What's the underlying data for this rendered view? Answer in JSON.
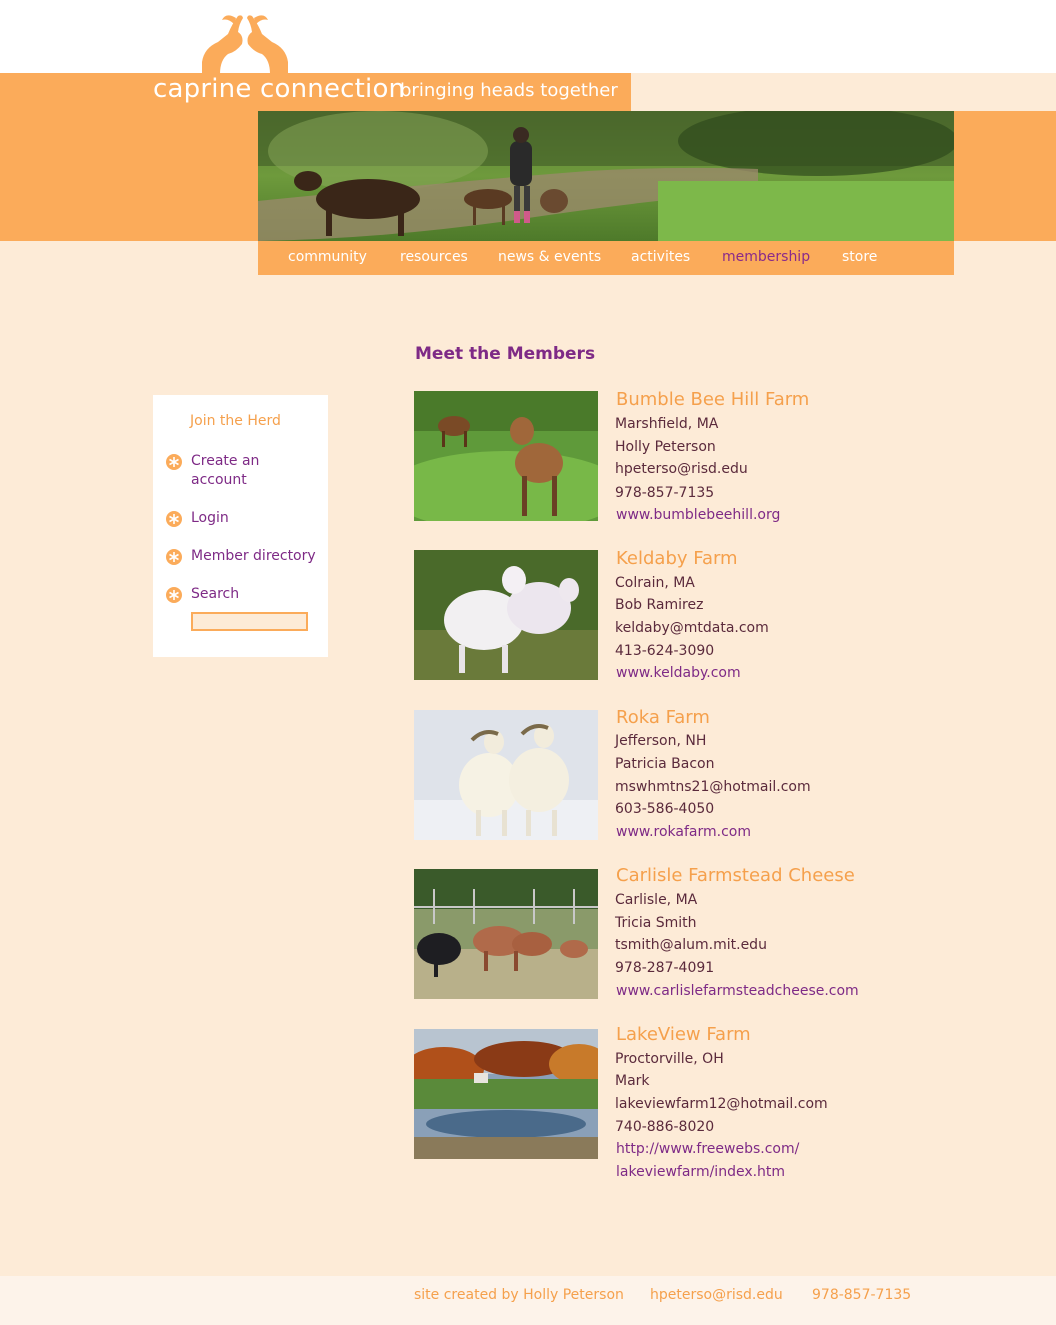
{
  "brand": {
    "name": "caprine connection",
    "tagline": "bringing heads together"
  },
  "colors": {
    "orange": "#fbab5a",
    "purple": "#7e2a86",
    "cream": "#fdebd7"
  },
  "nav": [
    {
      "label": "community"
    },
    {
      "label": "resources"
    },
    {
      "label": "news & events"
    },
    {
      "label": "activites"
    },
    {
      "label": "membership",
      "active": true
    },
    {
      "label": "store"
    }
  ],
  "sidebar": {
    "title": "Join the Herd",
    "links": [
      {
        "label": "Create an account"
      },
      {
        "label": "Login"
      },
      {
        "label": "Member directory"
      },
      {
        "label": "Search"
      }
    ]
  },
  "main": {
    "title": "Meet the Members",
    "farms": [
      {
        "name": "Bumble Bee Hill Farm",
        "location": "Marshfield, MA",
        "contact": "Holly Peterson",
        "email": "hpeterso@risd.edu",
        "phone": "978-857-7135",
        "website": "www.bumblebeehill.org"
      },
      {
        "name": "Keldaby Farm",
        "location": "Colrain, MA",
        "contact": "Bob Ramirez",
        "email": "keldaby@mtdata.com",
        "phone": "413-624-3090",
        "website": "www.keldaby.com"
      },
      {
        "name": "Roka Farm",
        "location": "Jefferson, NH",
        "contact": "Patricia Bacon",
        "email": "mswhmtns21@hotmail.com",
        "phone": "603-586-4050",
        "website": "www.rokafarm.com"
      },
      {
        "name": "Carlisle Farmstead Cheese",
        "location": "Carlisle, MA",
        "contact": "Tricia Smith",
        "email": "tsmith@alum.mit.edu",
        "phone": "978-287-4091",
        "website": "www.carlislefarmsteadcheese.com"
      },
      {
        "name": "LakeView Farm",
        "location": "Proctorville, OH",
        "contact": "Mark",
        "email": "lakeviewfarm12@hotmail.com",
        "phone": "740-886-8020",
        "website_line1": "http://www.freewebs.com/",
        "website_line2": "lakeviewfarm/index.htm"
      }
    ]
  },
  "footer": {
    "credit": "site created by Holly Peterson",
    "email": "hpeterso@risd.edu",
    "phone": "978-857-7135"
  }
}
